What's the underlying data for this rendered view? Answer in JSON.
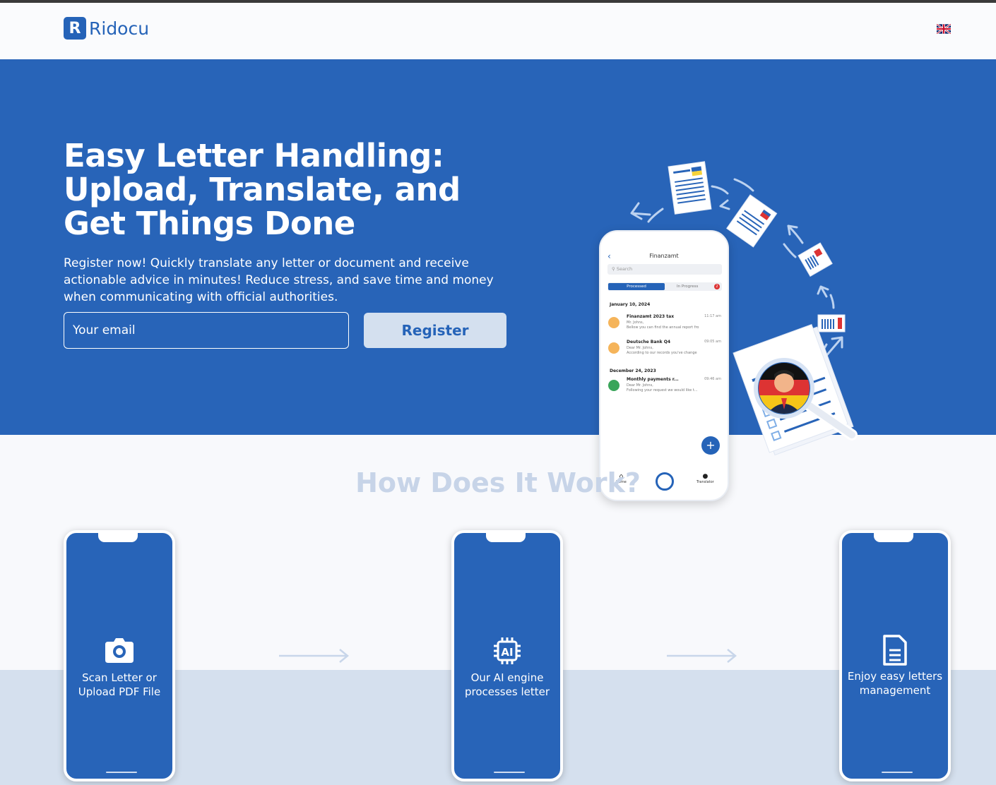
{
  "header": {
    "logo_mark": "R",
    "logo_text": "Ridocu",
    "language_flag_icon": "uk-flag-icon"
  },
  "hero": {
    "title": "Easy Letter Handling: Upload, Translate, and Get Things Done",
    "description": "Register now! Quickly translate any letter or document and receive actionable advice in minutes! Reduce stress, and save time and money when communicating with official authorities.",
    "email_placeholder": "Your email",
    "register_label": "Register"
  },
  "app_mockup": {
    "title": "Finanzamt",
    "search_placeholder": "Search",
    "tabs": [
      "Processed",
      "In Progress"
    ],
    "in_progress_count": "2",
    "groups": [
      {
        "date": "January 10, 2024",
        "items": [
          {
            "name": "Finanzamt 2023 tax",
            "time": "11:17 am",
            "line1": "Mr. Johns,",
            "line2": "Bellow you can find the annual report fro",
            "color": "#f5b45a"
          },
          {
            "name": "Deutsche Bank Q4",
            "time": "09:05 am",
            "line1": "Dear Mr. Johns,",
            "line2": "According to our records you've change",
            "color": "#f5b45a"
          }
        ]
      },
      {
        "date": "December 24, 2023",
        "items": [
          {
            "name": "Monthly payments r...",
            "time": "09:46 am",
            "line1": "Dear  Mr. Johns,",
            "line2": "Following your request we would like t...",
            "color": "#3aa55a"
          }
        ]
      }
    ],
    "nav": [
      "Home",
      "Translator"
    ],
    "fab": "+"
  },
  "how": {
    "title": "How Does It Work?",
    "steps": [
      {
        "label": "Scan Letter or Upload PDF File",
        "icon": "camera-icon"
      },
      {
        "label": "Our AI engine processes letter",
        "icon": "ai-chip-icon"
      },
      {
        "label": "Enjoy easy letters management",
        "icon": "document-icon"
      }
    ]
  },
  "colors": {
    "brand_blue": "#2864b8",
    "button_bg": "#d4e0ef",
    "band": "#d5e0ee"
  }
}
